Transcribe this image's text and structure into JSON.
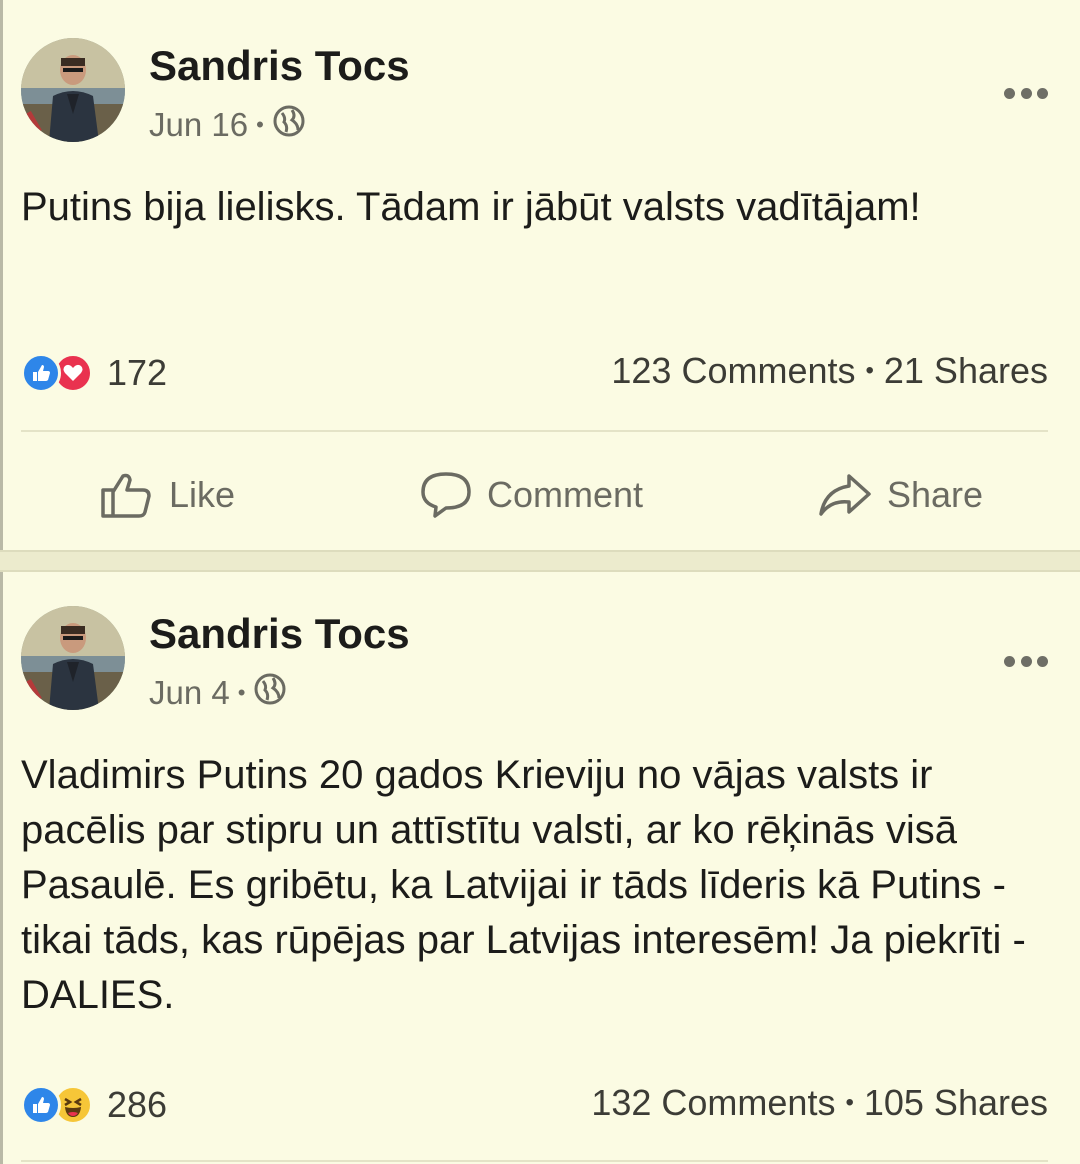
{
  "posts": [
    {
      "author": "Sandris Tocs",
      "date": "Jun 16",
      "privacy_icon": "globe-icon",
      "text": "Putins bija lielisks. Tādam ir jābūt valsts vadītājam!",
      "reactions": [
        "like",
        "love"
      ],
      "reaction_count": "172",
      "comments": "123 Comments",
      "shares": "21 Shares",
      "actions": {
        "like": "Like",
        "comment": "Comment",
        "share": "Share"
      }
    },
    {
      "author": "Sandris Tocs",
      "date": "Jun 4",
      "privacy_icon": "globe-icon",
      "text": "Vladimirs Putins 20 gados Krieviju no vājas valsts ir pacēlis par stipru un attīstītu valsti, ar ko rēķinās visā Pasaulē. Es gribētu, ka Latvijai ir tāds līderis kā Putins - tikai tāds, kas rūpējas par Latvijas interesēm! Ja piekrīti - DALIES.",
      "reactions": [
        "like",
        "haha"
      ],
      "reaction_count": "286",
      "comments": "132 Comments",
      "shares": "105 Shares"
    }
  ],
  "colors": {
    "background": "#fbfbe3",
    "like_blue": "#2e86e9",
    "love_red": "#e9324f",
    "haha_yellow": "#f6c638"
  }
}
